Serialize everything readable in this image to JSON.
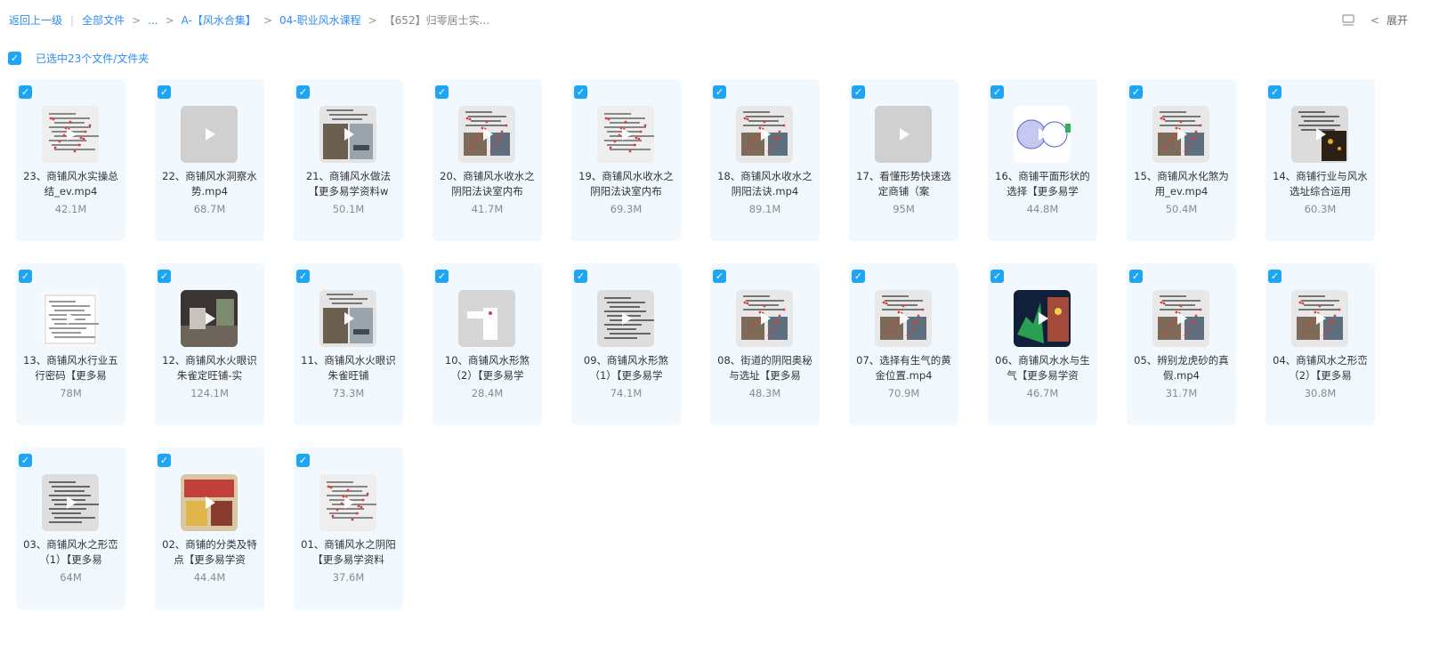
{
  "breadcrumb": {
    "back": "返回上一级",
    "items": [
      "全部文件",
      "...",
      "A-【风水合集】",
      "04-职业风水课程"
    ],
    "current": "【652】归零居士实..."
  },
  "toolbar": {
    "collapse_label": "展开"
  },
  "selection": {
    "label": "已选中23个文件/文件夹"
  },
  "colors": {
    "accent": "#2f8cf4",
    "checkbox": "#1ea6f5",
    "card_bg": "#f1f8fe"
  },
  "files": [
    {
      "name": "23、商铺风水实操总结_ev.mp4",
      "size": "42.1M",
      "thumb": "slide-red"
    },
    {
      "name": "22、商铺风水洞察水势.mp4",
      "size": "68.7M",
      "thumb": "gray"
    },
    {
      "name": "21、商铺风水做法【更多易学资料w",
      "size": "50.1M",
      "thumb": "street-photo"
    },
    {
      "name": "20、商铺风水收水之阴阳法诀室内布",
      "size": "41.7M",
      "thumb": "slide-photo"
    },
    {
      "name": "19、商铺风水收水之阴阳法诀室内布",
      "size": "69.3M",
      "thumb": "slide-red"
    },
    {
      "name": "18、商铺风水收水之阴阳法诀.mp4",
      "size": "89.1M",
      "thumb": "slide-photo"
    },
    {
      "name": "17、看懂形势快速选定商铺（案",
      "size": "95M",
      "thumb": "gray"
    },
    {
      "name": "16、商铺平面形状的选择【更多易学",
      "size": "44.8M",
      "thumb": "diagram-blue"
    },
    {
      "name": "15、商铺风水化煞为用_ev.mp4",
      "size": "50.4M",
      "thumb": "slide-photo"
    },
    {
      "name": "14、商铺行业与风水选址综合运用",
      "size": "60.3M",
      "thumb": "slide-night"
    },
    {
      "name": "13、商铺风水行业五行密码【更多易",
      "size": "78M",
      "thumb": "document"
    },
    {
      "name": "12、商铺风水火眼识朱雀定旺铺-实",
      "size": "124.1M",
      "thumb": "street-dark"
    },
    {
      "name": "11、商铺风水火眼识朱雀旺铺",
      "size": "73.3M",
      "thumb": "street-photo"
    },
    {
      "name": "10、商铺风水形煞（2）【更多易学",
      "size": "28.4M",
      "thumb": "diagram-gray"
    },
    {
      "name": "09、商铺风水形煞（1）【更多易学",
      "size": "74.1M",
      "thumb": "slide-text"
    },
    {
      "name": "08、街道的阴阳奥秘与选址【更多易",
      "size": "48.3M",
      "thumb": "slide-photo"
    },
    {
      "name": "07、选择有生气的黄金位置.mp4",
      "size": "70.9M",
      "thumb": "slide-photo"
    },
    {
      "name": "06、商铺风水水与生气【更多易学资",
      "size": "46.7M",
      "thumb": "map-dark"
    },
    {
      "name": "05、辨别龙虎砂的真假.mp4",
      "size": "31.7M",
      "thumb": "slide-photo"
    },
    {
      "name": "04、商铺风水之形峦（2）【更多易",
      "size": "30.8M",
      "thumb": "slide-photo"
    },
    {
      "name": "03、商铺风水之形峦（1）【更多易",
      "size": "64M",
      "thumb": "slide-text"
    },
    {
      "name": "02、商铺的分类及特点【更多易学资",
      "size": "44.4M",
      "thumb": "street-color"
    },
    {
      "name": "01、商铺风水之阴阳【更多易学资料",
      "size": "37.6M",
      "thumb": "slide-red"
    }
  ]
}
